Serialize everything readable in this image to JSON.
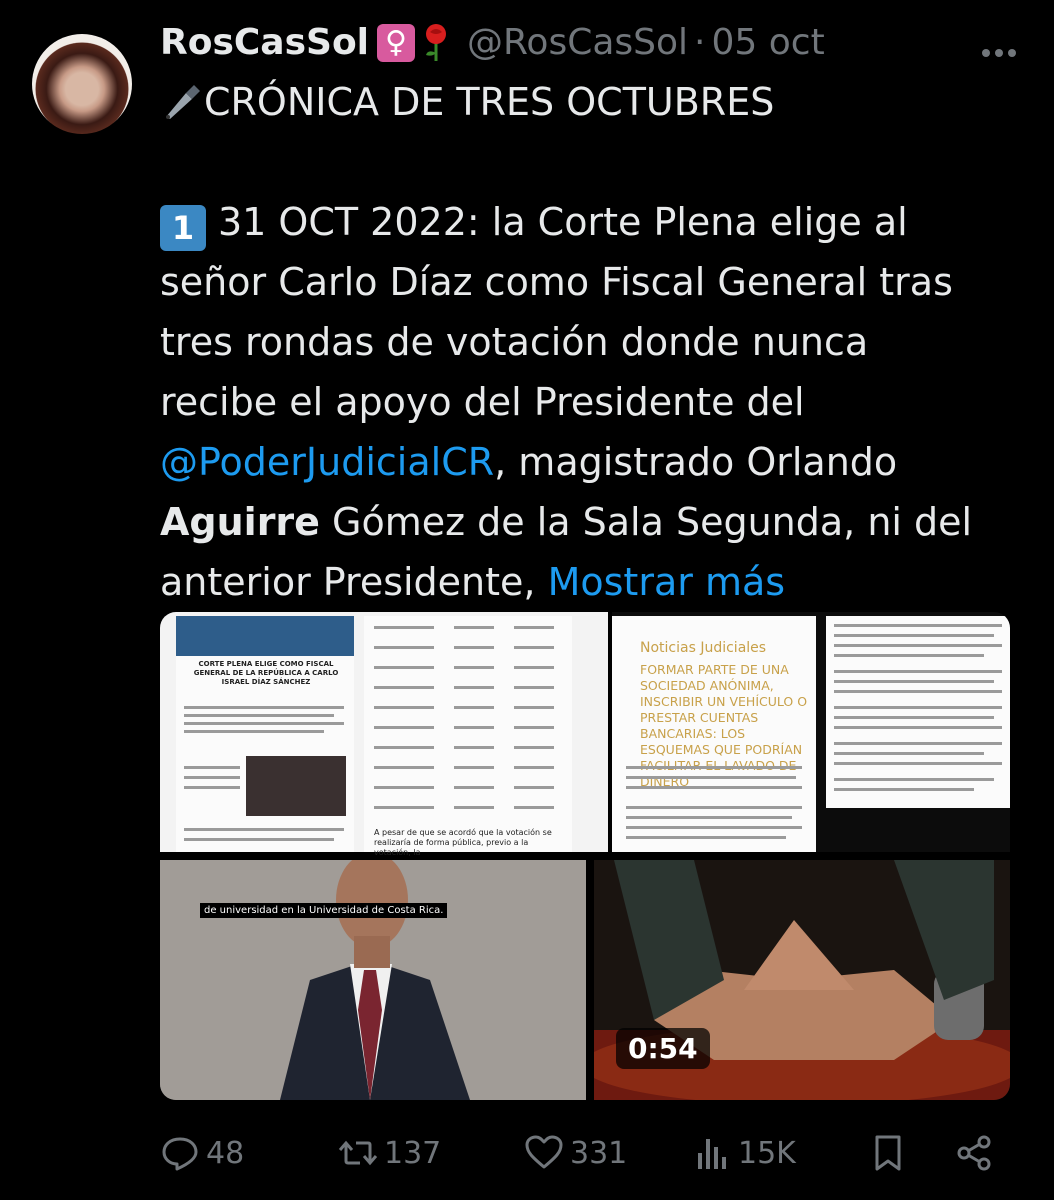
{
  "tweet": {
    "display_name": "RosCasSol",
    "handle": "@RosCasSol",
    "separator": "·",
    "date": "05 oct",
    "emoji_venus": "♀",
    "title": "CRÓNICA DE TRES OCTUBRES",
    "keycap": "1",
    "lines": [
      "31 OCT 2022: la Corte Plena elige al",
      "señor Carlo Díaz como Fiscal General tras",
      "tres rondas de votación donde nunca",
      "recibe el apoyo del Presidente del"
    ],
    "mention": "@PoderJudicialCR",
    "mention_rest": ", magistrado Orlando",
    "bold_word": "Aguirre",
    "line7_rest": " Gómez de la Sala Segunda, ni del",
    "line8": "anterior Presidente,",
    "show_more": "Mostrar más"
  },
  "media": {
    "video_caption": "de universidad en la Universidad de Costa Rica.",
    "video_duration": "0:54",
    "doc1_heading": "CORTE PLENA ELIGE COMO FISCAL GENERAL DE LA REPÚBLICA A CARLO ISRAEL DÍAZ SÁNCHEZ",
    "doc2_footer": "A pesar de que se acordó que la votación se realizaría de forma pública, previo a la votación, la",
    "doc3_title": "Noticias Judiciales",
    "doc3_headline": "FORMAR PARTE DE UNA SOCIEDAD ANÓNIMA, INSCRIBIR UN VEHÍCULO O PRESTAR CUENTAS BANCARIAS: LOS ESQUEMAS QUE PODRÍAN FACILITAR EL LAVADO DE DINERO"
  },
  "actions": {
    "replies": "48",
    "reposts": "137",
    "likes": "331",
    "views": "15K"
  },
  "colors": {
    "background": "#000000",
    "text": "#e7e9ea",
    "muted": "#71767b",
    "link": "#1d9bf0"
  }
}
